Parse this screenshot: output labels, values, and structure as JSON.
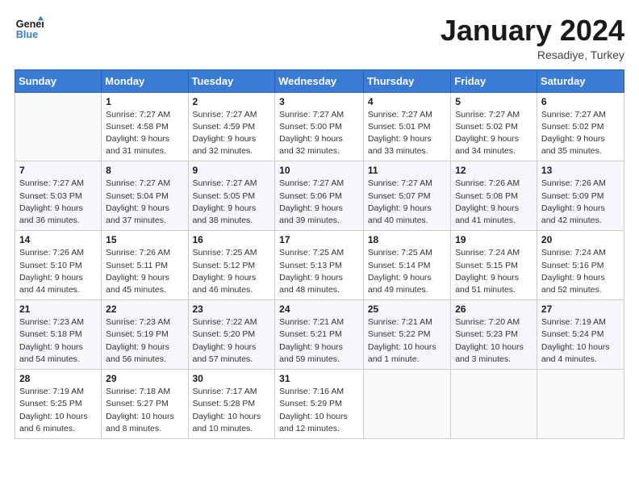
{
  "logo": {
    "line1": "General",
    "line2": "Blue"
  },
  "title": "January 2024",
  "location": "Resadiye, Turkey",
  "days_header": [
    "Sunday",
    "Monday",
    "Tuesday",
    "Wednesday",
    "Thursday",
    "Friday",
    "Saturday"
  ],
  "weeks": [
    [
      {
        "day": "",
        "info": ""
      },
      {
        "day": "1",
        "info": "Sunrise: 7:27 AM\nSunset: 4:58 PM\nDaylight: 9 hours\nand 31 minutes."
      },
      {
        "day": "2",
        "info": "Sunrise: 7:27 AM\nSunset: 4:59 PM\nDaylight: 9 hours\nand 32 minutes."
      },
      {
        "day": "3",
        "info": "Sunrise: 7:27 AM\nSunset: 5:00 PM\nDaylight: 9 hours\nand 32 minutes."
      },
      {
        "day": "4",
        "info": "Sunrise: 7:27 AM\nSunset: 5:01 PM\nDaylight: 9 hours\nand 33 minutes."
      },
      {
        "day": "5",
        "info": "Sunrise: 7:27 AM\nSunset: 5:02 PM\nDaylight: 9 hours\nand 34 minutes."
      },
      {
        "day": "6",
        "info": "Sunrise: 7:27 AM\nSunset: 5:02 PM\nDaylight: 9 hours\nand 35 minutes."
      }
    ],
    [
      {
        "day": "7",
        "info": "Sunrise: 7:27 AM\nSunset: 5:03 PM\nDaylight: 9 hours\nand 36 minutes."
      },
      {
        "day": "8",
        "info": "Sunrise: 7:27 AM\nSunset: 5:04 PM\nDaylight: 9 hours\nand 37 minutes."
      },
      {
        "day": "9",
        "info": "Sunrise: 7:27 AM\nSunset: 5:05 PM\nDaylight: 9 hours\nand 38 minutes."
      },
      {
        "day": "10",
        "info": "Sunrise: 7:27 AM\nSunset: 5:06 PM\nDaylight: 9 hours\nand 39 minutes."
      },
      {
        "day": "11",
        "info": "Sunrise: 7:27 AM\nSunset: 5:07 PM\nDaylight: 9 hours\nand 40 minutes."
      },
      {
        "day": "12",
        "info": "Sunrise: 7:26 AM\nSunset: 5:08 PM\nDaylight: 9 hours\nand 41 minutes."
      },
      {
        "day": "13",
        "info": "Sunrise: 7:26 AM\nSunset: 5:09 PM\nDaylight: 9 hours\nand 42 minutes."
      }
    ],
    [
      {
        "day": "14",
        "info": "Sunrise: 7:26 AM\nSunset: 5:10 PM\nDaylight: 9 hours\nand 44 minutes."
      },
      {
        "day": "15",
        "info": "Sunrise: 7:26 AM\nSunset: 5:11 PM\nDaylight: 9 hours\nand 45 minutes."
      },
      {
        "day": "16",
        "info": "Sunrise: 7:25 AM\nSunset: 5:12 PM\nDaylight: 9 hours\nand 46 minutes."
      },
      {
        "day": "17",
        "info": "Sunrise: 7:25 AM\nSunset: 5:13 PM\nDaylight: 9 hours\nand 48 minutes."
      },
      {
        "day": "18",
        "info": "Sunrise: 7:25 AM\nSunset: 5:14 PM\nDaylight: 9 hours\nand 49 minutes."
      },
      {
        "day": "19",
        "info": "Sunrise: 7:24 AM\nSunset: 5:15 PM\nDaylight: 9 hours\nand 51 minutes."
      },
      {
        "day": "20",
        "info": "Sunrise: 7:24 AM\nSunset: 5:16 PM\nDaylight: 9 hours\nand 52 minutes."
      }
    ],
    [
      {
        "day": "21",
        "info": "Sunrise: 7:23 AM\nSunset: 5:18 PM\nDaylight: 9 hours\nand 54 minutes."
      },
      {
        "day": "22",
        "info": "Sunrise: 7:23 AM\nSunset: 5:19 PM\nDaylight: 9 hours\nand 56 minutes."
      },
      {
        "day": "23",
        "info": "Sunrise: 7:22 AM\nSunset: 5:20 PM\nDaylight: 9 hours\nand 57 minutes."
      },
      {
        "day": "24",
        "info": "Sunrise: 7:21 AM\nSunset: 5:21 PM\nDaylight: 9 hours\nand 59 minutes."
      },
      {
        "day": "25",
        "info": "Sunrise: 7:21 AM\nSunset: 5:22 PM\nDaylight: 10 hours\nand 1 minute."
      },
      {
        "day": "26",
        "info": "Sunrise: 7:20 AM\nSunset: 5:23 PM\nDaylight: 10 hours\nand 3 minutes."
      },
      {
        "day": "27",
        "info": "Sunrise: 7:19 AM\nSunset: 5:24 PM\nDaylight: 10 hours\nand 4 minutes."
      }
    ],
    [
      {
        "day": "28",
        "info": "Sunrise: 7:19 AM\nSunset: 5:25 PM\nDaylight: 10 hours\nand 6 minutes."
      },
      {
        "day": "29",
        "info": "Sunrise: 7:18 AM\nSunset: 5:27 PM\nDaylight: 10 hours\nand 8 minutes."
      },
      {
        "day": "30",
        "info": "Sunrise: 7:17 AM\nSunset: 5:28 PM\nDaylight: 10 hours\nand 10 minutes."
      },
      {
        "day": "31",
        "info": "Sunrise: 7:16 AM\nSunset: 5:29 PM\nDaylight: 10 hours\nand 12 minutes."
      },
      {
        "day": "",
        "info": ""
      },
      {
        "day": "",
        "info": ""
      },
      {
        "day": "",
        "info": ""
      }
    ]
  ]
}
